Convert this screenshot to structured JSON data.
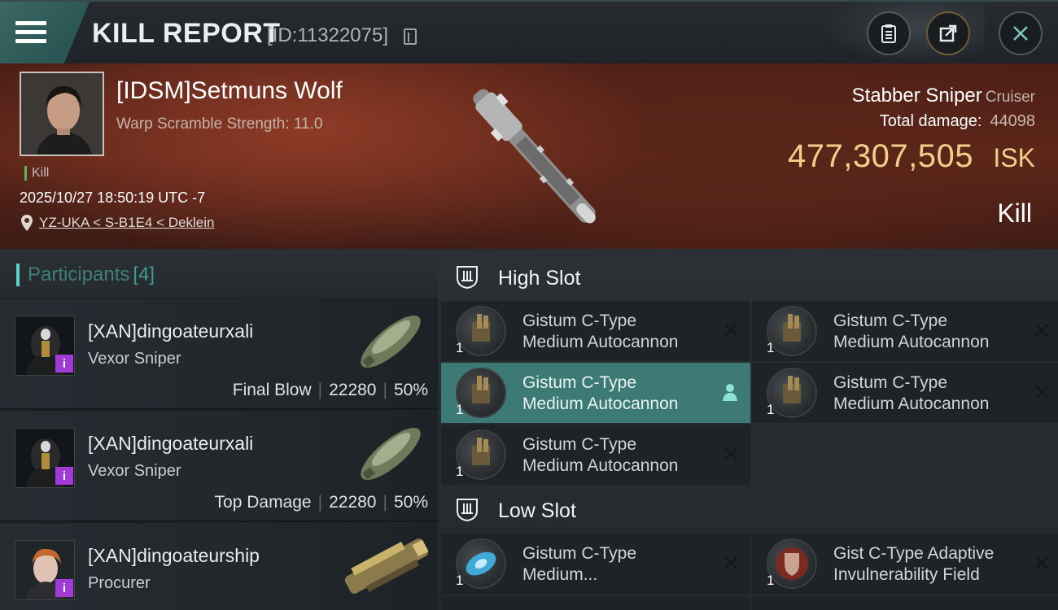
{
  "header": {
    "title": "KILL REPORT",
    "report_id": "[ID:11322075]"
  },
  "victim": {
    "name": "[IDSM]Setmuns Wolf",
    "warp_scramble": "Warp Scramble Strength: 11.0",
    "tag": "Kill",
    "timestamp": "2025/10/27 18:50:19 UTC -7",
    "location": "YZ-UKA < S-B1E4 < Deklein",
    "ship_name": "Stabber Sniper",
    "ship_class": "Cruiser",
    "total_damage_label": "Total damage:",
    "total_damage": "44098",
    "isk_value": "477,307,505",
    "isk_unit": "ISK",
    "result": "Kill"
  },
  "participants": {
    "label": "Participants",
    "count": "[4]",
    "items": [
      {
        "name": "[XAN]dingoateurxali",
        "ship": "Vexor Sniper",
        "role": "Final Blow",
        "damage": "22280",
        "percent": "50%",
        "badge": "i"
      },
      {
        "name": "[XAN]dingoateurxali",
        "ship": "Vexor Sniper",
        "role": "Top Damage",
        "damage": "22280",
        "percent": "50%",
        "badge": "i"
      },
      {
        "name": "[XAN]dingoateurship",
        "ship": "Procurer",
        "role": "",
        "damage": "",
        "percent": "",
        "badge": "i"
      }
    ]
  },
  "fitting": {
    "high_slot": {
      "title": "High Slot",
      "modules": [
        {
          "line1": "Gistum C-Type",
          "line2": "Medium Autocannon",
          "qty": "1"
        },
        {
          "line1": "Gistum C-Type",
          "line2": "Medium Autocannon",
          "qty": "1"
        },
        {
          "line1": "Gistum C-Type",
          "line2": "Medium Autocannon",
          "qty": "1"
        },
        {
          "line1": "Gistum C-Type",
          "line2": "Medium Autocannon",
          "qty": "1"
        },
        {
          "line1": "Gistum C-Type",
          "line2": "Medium Autocannon",
          "qty": "1"
        }
      ]
    },
    "low_slot": {
      "title": "Low Slot",
      "modules": [
        {
          "line1": "Gistum C-Type",
          "line2": "Medium...",
          "qty": "1"
        },
        {
          "line1": "Gist C-Type Adaptive",
          "line2": "Invulnerability Field",
          "qty": "1"
        }
      ]
    }
  },
  "colors": {
    "accent_teal": "#5ad2c6",
    "isk_gold": "#f3cf8a",
    "active_module": "#3e7a75",
    "badge_purple": "#a23ad6"
  },
  "icons": [
    "menu-icon",
    "copy-icon",
    "clipboard-icon",
    "share-icon",
    "close-icon",
    "location-pin-icon",
    "slot-icon",
    "remove-icon",
    "pilot-icon"
  ]
}
